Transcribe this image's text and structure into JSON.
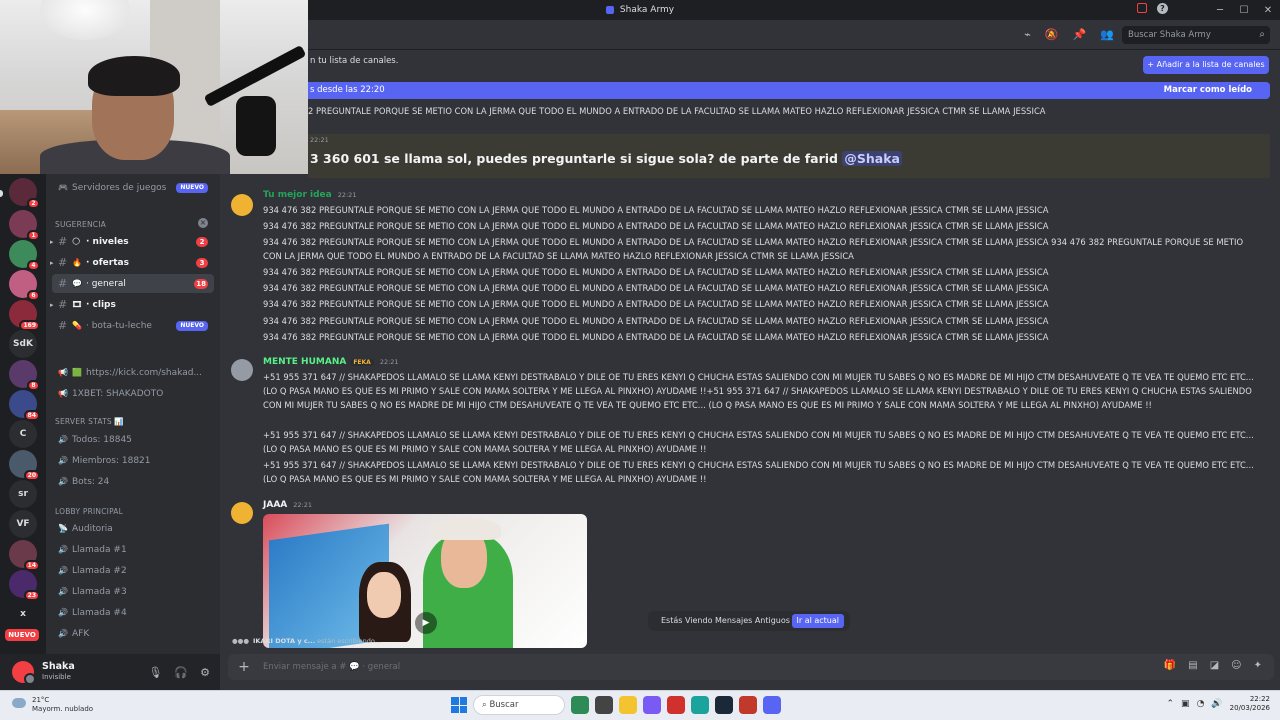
{
  "window": {
    "title": "Shaka Army",
    "search_placeholder": "Buscar Shaka Army"
  },
  "server_rail": {
    "labels": [
      "SdK",
      "C",
      "sr",
      "VF",
      "x"
    ],
    "badges": [
      "2",
      "1",
      "4",
      "6",
      "169",
      "8",
      "84",
      "20",
      "14",
      "23"
    ],
    "new_label": "NUEVO"
  },
  "channels": {
    "games": {
      "label": "Servidores de juegos",
      "badge": "NUEVO"
    },
    "sugerencia_cat": "Sugerencia",
    "items": [
      {
        "label": "· niveles",
        "count": "2"
      },
      {
        "label": "· ofertas",
        "count": "3"
      },
      {
        "label": "· general",
        "count": "18"
      },
      {
        "label": "· clips"
      },
      {
        "label": "· bota-tu-leche",
        "badge": "NUEVO"
      }
    ],
    "links": [
      "https://kick.com/shakad...",
      "1XBET: SHAKADOTO"
    ],
    "stats_cat": "SERVER STATS 📊",
    "stats": [
      "Todos: 18845",
      "Miembros: 18821",
      "Bots: 24"
    ],
    "lobby_cat": "LOBBY PRINCIPAL",
    "voice": [
      "Auditoria",
      "Llamada #1",
      "Llamada #2",
      "Llamada #3",
      "Llamada #4",
      "AFK"
    ]
  },
  "user": {
    "name": "Shaka",
    "status": "Invisible"
  },
  "notices": {
    "top": "n tu lista de canales.",
    "add_button": "+ Añadir a la lista de canales",
    "new_since": "s desde las 22:20",
    "mark_read": "Marcar como leído"
  },
  "messages": {
    "cut_line": "2 PREGUNTALE PORQUE SE METIO CON LA JERMA QUE TODO EL MUNDO A ENTRADO DE LA FACULTAD SE LLAMA MATEO HAZLO REFLEXIONAR  JESSICA CTMR SE LLAMA JESSICA",
    "highlight_time": "22:21",
    "highlight_text": "3 360 601 se llama sol, puedes preguntarle si sigue sola? de parte de farid ",
    "highlight_mention": "@Shaka",
    "m1": {
      "author": "Tu mejor idea",
      "time": "22:21",
      "lines": [
        "934 476 382 PREGUNTALE PORQUE SE METIO CON LA JERMA QUE TODO EL MUNDO A ENTRADO DE LA FACULTAD SE LLAMA MATEO HAZLO REFLEXIONAR  JESSICA CTMR SE LLAMA JESSICA",
        "934 476 382 PREGUNTALE PORQUE SE METIO CON LA JERMA QUE TODO EL MUNDO A ENTRADO DE LA FACULTAD SE LLAMA MATEO HAZLO REFLEXIONAR  JESSICA CTMR SE LLAMA JESSICA",
        "934 476 382 PREGUNTALE PORQUE SE METIO CON LA JERMA QUE TODO EL MUNDO A ENTRADO DE LA FACULTAD SE LLAMA MATEO HAZLO REFLEXIONAR  JESSICA CTMR SE LLAMA JESSICA 934 476 382 PREGUNTALE PORQUE SE METIO CON LA JERMA QUE TODO EL MUNDO A ENTRADO DE LA FACULTAD SE LLAMA MATEO HAZLO REFLEXIONAR  JESSICA CTMR SE LLAMA JESSICA",
        "934 476 382 PREGUNTALE PORQUE SE METIO CON LA JERMA QUE TODO EL MUNDO A ENTRADO DE LA FACULTAD SE LLAMA MATEO HAZLO REFLEXIONAR  JESSICA CTMR SE LLAMA JESSICA",
        "934 476 382 PREGUNTALE PORQUE SE METIO CON LA JERMA QUE TODO EL MUNDO A ENTRADO DE LA FACULTAD SE LLAMA MATEO HAZLO REFLEXIONAR  JESSICA CTMR SE LLAMA JESSICA",
        "934 476 382 PREGUNTALE PORQUE SE METIO CON LA JERMA QUE TODO EL MUNDO A ENTRADO DE LA FACULTAD SE LLAMA MATEO HAZLO REFLEXIONAR  JESSICA CTMR SE LLAMA JESSICA",
        "934 476 382 PREGUNTALE PORQUE SE METIO CON LA JERMA QUE TODO EL MUNDO A ENTRADO DE LA FACULTAD SE LLAMA MATEO HAZLO REFLEXIONAR  JESSICA CTMR SE LLAMA JESSICA",
        "934 476 382 PREGUNTALE PORQUE SE METIO CON LA JERMA QUE TODO EL MUNDO A ENTRADO DE LA FACULTAD SE LLAMA MATEO HAZLO REFLEXIONAR  JESSICA CTMR SE LLAMA JESSICA"
      ]
    },
    "m2": {
      "author": "MENTE HUMANA",
      "tag": "FEKA",
      "time": "22:21",
      "lines": [
        "+51 955 371 647 // SHAKAPEDOS LLAMALO SE LLAMA KENYI DESTRABALO Y DILE OE TU ERES KENYI Q CHUCHA ESTAS SALIENDO CON MI MUJER TU SABES Q NO ES MADRE DE MI HIJO CTM DESAHUVEATE Q TE VEA TE QUEMO ETC ETC...  (LO Q PASA MANO ES QUE ES MI PRIMO Y SALE CON MAMA SOLTERA Y ME LLEGA AL PINXHO) AYUDAME !!+51 955 371 647 // SHAKAPEDOS LLAMALO SE LLAMA KENYI DESTRABALO Y DILE OE TU ERES KENYI Q CHUCHA ESTAS SALIENDO CON MI MUJER TU SABES Q NO ES MADRE DE MI HIJO CTM DESAHUVEATE Q TE VEA TE QUEMO ETC ETC...  (LO Q PASA MANO ES QUE ES MI PRIMO Y SALE CON MAMA SOLTERA Y ME LLEGA AL PINXHO) AYUDAME !!",
        "+51 955 371 647 // SHAKAPEDOS LLAMALO SE LLAMA KENYI DESTRABALO Y DILE OE TU ERES KENYI Q CHUCHA ESTAS SALIENDO CON MI MUJER TU SABES Q NO ES MADRE DE MI HIJO CTM DESAHUVEATE Q TE VEA TE QUEMO ETC ETC...  (LO Q PASA MANO ES QUE ES MI PRIMO Y SALE CON MAMA SOLTERA Y ME LLEGA AL PINXHO) AYUDAME !!",
        "+51 955 371 647 // SHAKAPEDOS LLAMALO SE LLAMA KENYI DESTRABALO Y DILE OE TU ERES KENYI Q CHUCHA ESTAS SALIENDO CON MI MUJER TU SABES Q NO ES MADRE DE MI HIJO CTM DESAHUVEATE Q TE VEA TE QUEMO ETC ETC...  (LO Q PASA MANO ES QUE ES MI PRIMO Y SALE CON MAMA SOLTERA Y ME LLEGA AL PINXHO) AYUDAME !!"
      ]
    },
    "m3": {
      "author": "JAAA",
      "time": "22:21"
    }
  },
  "old_messages": {
    "text": "Estás Viendo Mensajes Antiguos",
    "button": "Ir al actual"
  },
  "typing": {
    "names": "IKARI DOTA y c...",
    "text": "están escribiendo..."
  },
  "composer": {
    "placeholder": "Enviar mensaje a # 💬 · general"
  },
  "taskbar": {
    "weather_temp": "21°C",
    "weather_desc": "Mayorm. nublado",
    "search": "Buscar",
    "time": "22:22",
    "date": "20/03/2026"
  },
  "colors": {
    "accent": "#5865f2",
    "danger": "#f23f43",
    "green": "#23a55a",
    "mention_bg": "#3b3a33"
  }
}
